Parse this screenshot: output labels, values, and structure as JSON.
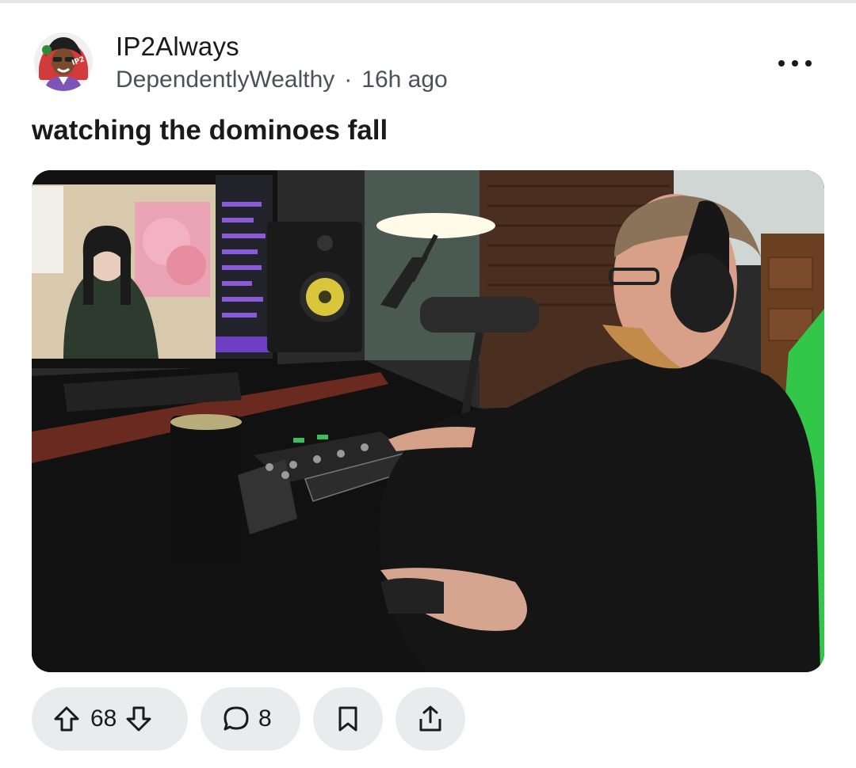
{
  "post": {
    "author": "IP2Always",
    "community": "DependentlyWealthy",
    "separator": "·",
    "time_ago": "16h ago",
    "title": "watching the dominoes fall",
    "avatar_icon": "avatar-image",
    "avatar_badge_text": "IP2",
    "image": {
      "description_icon": "post-photo"
    }
  },
  "actions": {
    "upvote_icon": "arrow-up-icon",
    "vote_count": "68",
    "downvote_icon": "arrow-down-icon",
    "comment_icon": "speech-bubble-icon",
    "comment_count": "8",
    "save_icon": "bookmark-icon",
    "share_icon": "share-icon",
    "more_icon": "more-dots-icon"
  },
  "colors": {
    "pill_bg": "#e9ebed",
    "text": "#1a1a1b",
    "meta_text": "#4b5157"
  }
}
